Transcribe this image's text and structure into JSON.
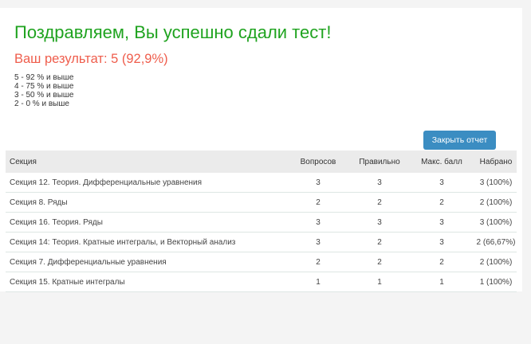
{
  "title": "Поздравляем, Вы успешно сдали тест!",
  "result": "Ваш результат: 5 (92,9%)",
  "grades": [
    "5 - 92 % и выше",
    "4 - 75 % и выше",
    "3 - 50 % и выше",
    "2 - 0 % и выше"
  ],
  "close_button": "Закрыть отчет",
  "table": {
    "headers": [
      "Секция",
      "Вопросов",
      "Правильно",
      "Макс. балл",
      "Набрано"
    ],
    "rows": [
      [
        "Секция 12. Теория. Дифференциальные уравнения",
        "3",
        "3",
        "3",
        "3 (100%)"
      ],
      [
        "Секция 8. Ряды",
        "2",
        "2",
        "2",
        "2 (100%)"
      ],
      [
        "Секция 16. Теория. Ряды",
        "3",
        "3",
        "3",
        "3 (100%)"
      ],
      [
        "Секция 14: Теория. Кратные интегралы, и Векторный анализ",
        "3",
        "2",
        "3",
        "2 (66,67%)"
      ],
      [
        "Секция 7. Дифференциальные уравнения",
        "2",
        "2",
        "2",
        "2 (100%)"
      ],
      [
        "Секция 15. Кратные интегралы",
        "1",
        "1",
        "1",
        "1 (100%)"
      ]
    ]
  }
}
